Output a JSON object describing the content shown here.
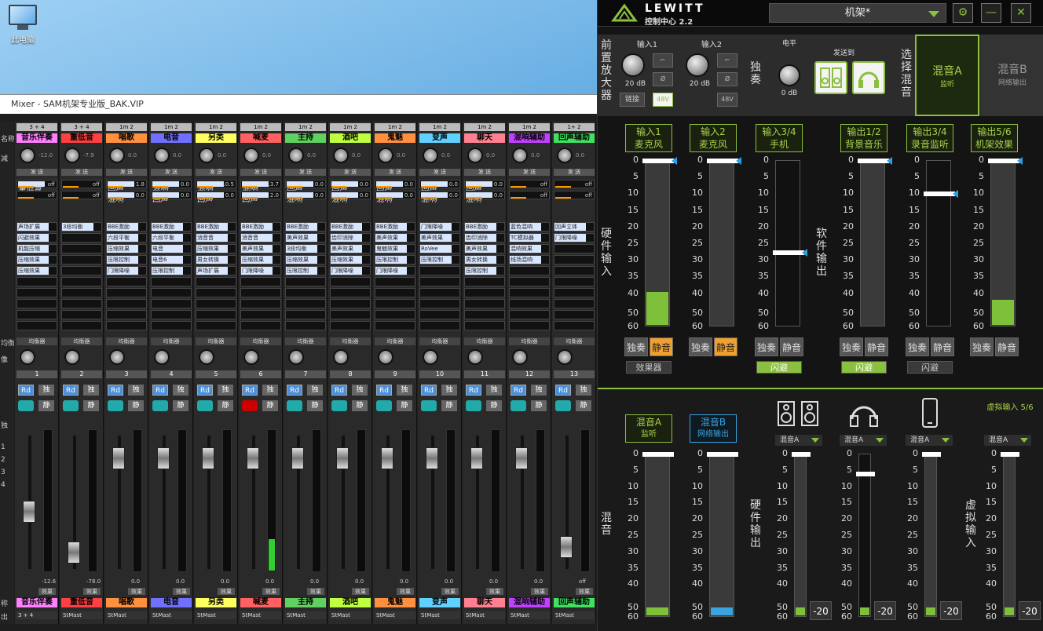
{
  "desktop": {
    "icon_label": "此电脑"
  },
  "mixer": {
    "title": "Mixer - SAM机架专业版_BAK.VIP",
    "row_labels": [
      "名称",
      "减",
      "",
      "",
      "",
      "",
      "",
      "",
      "均衡",
      "像",
      "",
      "",
      "独",
      "1",
      "2",
      "3",
      "4",
      "称",
      "出"
    ],
    "channels": [
      {
        "num": "",
        "sel": "3 + 4",
        "name": "音乐伴奏",
        "color": "#ff80ff",
        "gain": "-12.0",
        "sends": [
          "重低音",
          "off",
          "",
          "off"
        ],
        "fx": [
          "声场扩展",
          "闪避效果",
          "机能压缩",
          "压缩效果",
          "压缩效果"
        ],
        "fval": "-12.6",
        "out": "3 + 4",
        "fader": 0.55
      },
      {
        "num": "2",
        "sel": "3 + 4",
        "name": "重低音",
        "color": "#ff4040",
        "gain": "-7.9",
        "sends": [
          "",
          "off",
          "",
          "off"
        ],
        "fx": [
          "3段均衡",
          "",
          "",
          "",
          ""
        ],
        "fval": "-78.0",
        "out": "StMast",
        "fader": 0.9
      },
      {
        "num": "3",
        "sel": "1m 2",
        "name": "唱歌",
        "color": "#ff9040",
        "gain": "0.0",
        "sends": [
          "回声",
          "1.8",
          "混响",
          "0.0"
        ],
        "fx": [
          "BBE激励",
          "六段平衡",
          "压缩效果",
          "压限控制",
          "门限降噪"
        ],
        "fval": "0.0",
        "out": "StMast",
        "fader": 0.1
      },
      {
        "num": "4",
        "sel": "1m 2",
        "name": "电音",
        "color": "#7070ff",
        "gain": "0.0",
        "sends": [
          "混响",
          "0.0",
          "回声",
          "0.0"
        ],
        "fx": [
          "BBE激励",
          "六段平衡",
          "电音",
          "电音6",
          "压限控制"
        ],
        "fval": "0.0",
        "out": "StMast",
        "fader": 0.1
      },
      {
        "num": "5",
        "sel": "1m 2",
        "name": "另类",
        "color": "#ffff60",
        "gain": "0.0",
        "sends": [
          "混响",
          "-10.5",
          "回声",
          "0.0"
        ],
        "fx": [
          "BBE激励",
          "消音音",
          "压缩效果",
          "男女转换",
          "声场扩展"
        ],
        "fval": "0.0",
        "out": "StMast",
        "fader": 0.1
      },
      {
        "num": "6",
        "sel": "1m 2",
        "name": "喊麦",
        "color": "#ff6060",
        "gain": "0.0",
        "sends": [
          "混响",
          "-13.7",
          "回声",
          "2.0"
        ],
        "fx": [
          "BBE激励",
          "消音音",
          "美声效果",
          "压缩效果",
          "门限降噪"
        ],
        "fval": "0.0",
        "out": "StMast",
        "fader": 0.1
      },
      {
        "num": "7",
        "sel": "1m 2",
        "name": "主持",
        "color": "#60d060",
        "gain": "0.0",
        "sends": [
          "回声",
          "0.0",
          "混响",
          "0.0"
        ],
        "fx": [
          "BBE激励",
          "美声效果",
          "3段均衡",
          "压缩效果",
          "压限控制"
        ],
        "fval": "0.0",
        "out": "StMast",
        "fader": 0.1
      },
      {
        "num": "8",
        "sel": "1m 2",
        "name": "酒吧",
        "color": "#c0ff40",
        "gain": "0.0",
        "sends": [
          "回声",
          "0.0",
          "混响",
          "0.0"
        ],
        "fx": [
          "BBE激励",
          "齿印消除",
          "美声效果",
          "压缩效果",
          "门限降噪"
        ],
        "fval": "0.0",
        "out": "StMast",
        "fader": 0.1
      },
      {
        "num": "9",
        "sel": "1m 2",
        "name": "鬼魅",
        "color": "#ff9040",
        "gain": "0.0",
        "sends": [
          "回声",
          "0.0",
          "混响",
          "0.0"
        ],
        "fx": [
          "BBE激励",
          "美声效果",
          "鬼魅效果",
          "压限控制",
          "门限降噪"
        ],
        "fval": "0.0",
        "out": "StMast",
        "fader": 0.1
      },
      {
        "num": "10",
        "sel": "1m 2",
        "name": "变声",
        "color": "#60d0ff",
        "gain": "0.0",
        "sends": [
          "回声",
          "0.0",
          "混响",
          "0.0"
        ],
        "fx": [
          "门限降噪",
          "美声效果",
          "RoVee",
          "压限控制",
          ""
        ],
        "fval": "0.0",
        "out": "StMast",
        "fader": 0.1
      },
      {
        "num": "11",
        "sel": "1m 2",
        "name": "聊天",
        "color": "#ff8090",
        "gain": "0.0",
        "sends": [
          "回声",
          "0.0",
          "混响",
          "0.0"
        ],
        "fx": [
          "BBE激励",
          "齿印消除",
          "美声效果",
          "男女转换",
          "压限控制"
        ],
        "fval": "0.0",
        "out": "StMast",
        "fader": 0.1
      },
      {
        "num": "12",
        "sel": "1m 2",
        "name": "混响辅助",
        "color": "#c040ff",
        "gain": "0.0",
        "sends": [
          "",
          "off",
          "",
          "off"
        ],
        "fx": [
          "蓝色混响",
          "TC模拟器",
          "混响效果",
          "线场混响",
          ""
        ],
        "fval": "0.0",
        "out": "StMast",
        "fader": 0.1
      },
      {
        "num": "13",
        "sel": "1+ 2",
        "name": "回声辅助",
        "color": "#40e060",
        "gain": "0.0",
        "sends": [
          "",
          "off",
          "",
          "off"
        ],
        "fx": [
          "回声立体",
          "门限降噪",
          "",
          "",
          ""
        ],
        "fval": "off",
        "out": "StMast",
        "fader": 0.85
      }
    ],
    "labels": {
      "send": "发 送",
      "eq": "均衡器",
      "rd": "Rd",
      "solo": "独",
      "mute": "静",
      "fx": "效果"
    }
  },
  "lewitt": {
    "brand": "LEWITT",
    "app": "控制中心 2.2",
    "preset": "机架*",
    "preamp_title": "前置放大器",
    "inputs": [
      {
        "title": "输入1",
        "db": "20 dB",
        "link": "链接",
        "phantom": "48V"
      },
      {
        "title": "输入2",
        "db": "20 dB",
        "link": "",
        "phantom": "48V"
      }
    ],
    "solo_label": "独奏",
    "level_label": "电平",
    "level_db": "0 dB",
    "send_to": "发送到",
    "select_mix": "选择混音",
    "mix_a": {
      "title": "混音A",
      "sub": "监听"
    },
    "mix_b": {
      "title": "混音B",
      "sub": "网络输出"
    },
    "hw_input_label": "硬件输入",
    "sw_output_label": "软件输出",
    "scale": [
      "0",
      "5",
      "10",
      "15",
      "20",
      "25",
      "30",
      "35",
      "40",
      "50",
      "60"
    ],
    "top_strips": [
      {
        "t1": "输入1",
        "t2": "麦克风",
        "level": 0.2,
        "handle": 0,
        "solo": "独奏",
        "mute": "静音",
        "mute_on": true,
        "tag": "效果器",
        "tag_on": false
      },
      {
        "t1": "输入2",
        "t2": "麦克风",
        "level": 0.0,
        "handle": 0,
        "solo": "独奏",
        "mute": "静音",
        "mute_on": true,
        "tag": "",
        "tag_on": false
      },
      {
        "t1": "输入3/4",
        "t2": "手机",
        "level": 0.0,
        "handle": 0.55,
        "solo": "独奏",
        "mute": "静音",
        "mute_on": false,
        "tag": "闪避",
        "tag_on": true
      },
      {
        "t1": "输出1/2",
        "t2": "背景音乐",
        "level": 0.0,
        "handle": 0,
        "solo": "独奏",
        "mute": "静音",
        "mute_on": false,
        "tag": "闪避",
        "tag_on": true
      },
      {
        "t1": "输出3/4",
        "t2": "录音监听",
        "level": 0.0,
        "handle": 0.2,
        "solo": "独奏",
        "mute": "静音",
        "mute_on": false,
        "tag": "闪避",
        "tag_on": false
      },
      {
        "t1": "输出5/6",
        "t2": "机架效果",
        "level": 0.15,
        "handle": 0,
        "solo": "独奏",
        "mute": "静音",
        "mute_on": false,
        "tag": "",
        "tag_on": false
      }
    ],
    "mix_label": "混音",
    "hw_output_label": "硬件输出",
    "virtual_input_label": "虚拟输入",
    "virtual_input_title": "虚拟输入 5/6",
    "bottom_scale": [
      "0",
      "5",
      "10",
      "15",
      "20",
      "25",
      "30",
      "35",
      "40",
      "50",
      "60"
    ],
    "dropdown_value": "混音A",
    "minus20": "-20"
  }
}
